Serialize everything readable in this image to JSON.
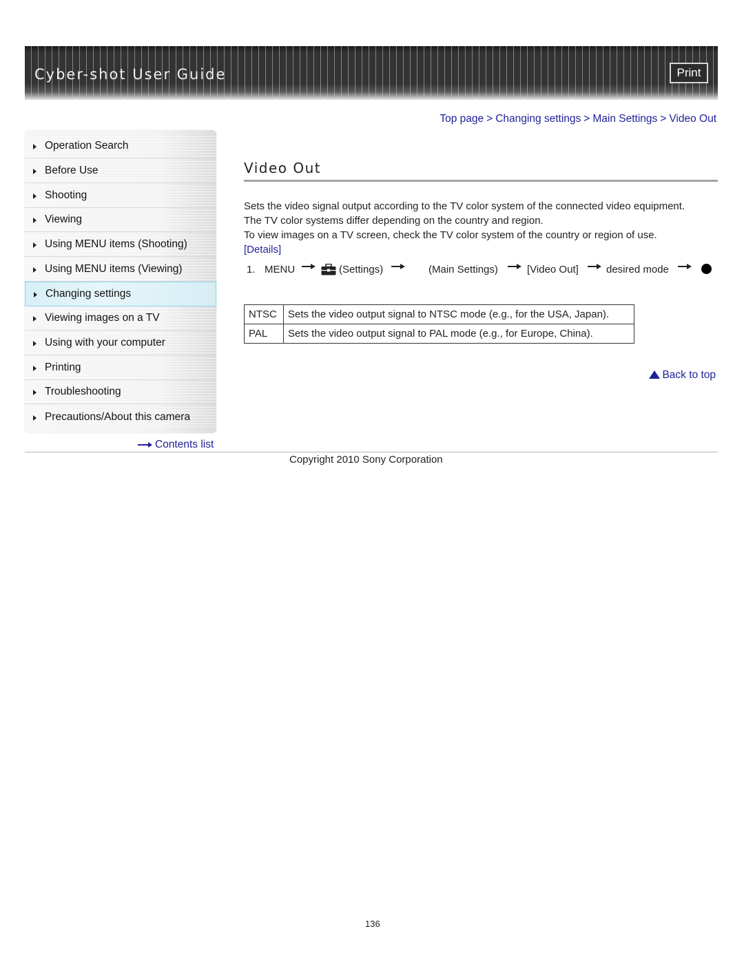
{
  "header": {
    "title": "Cyber-shot User Guide",
    "print_label": "Print"
  },
  "breadcrumb": {
    "items": [
      "Top page",
      "Changing settings",
      "Main Settings",
      "Video Out"
    ],
    "separator": ">"
  },
  "sidebar": {
    "items": [
      {
        "label": "Operation Search",
        "active": false
      },
      {
        "label": "Before Use",
        "active": false
      },
      {
        "label": "Shooting",
        "active": false
      },
      {
        "label": "Viewing",
        "active": false
      },
      {
        "label": "Using MENU items (Shooting)",
        "active": false
      },
      {
        "label": "Using MENU items (Viewing)",
        "active": false
      },
      {
        "label": "Changing settings",
        "active": true
      },
      {
        "label": "Viewing images on a TV",
        "active": false
      },
      {
        "label": "Using with your computer",
        "active": false
      },
      {
        "label": "Printing",
        "active": false
      },
      {
        "label": "Troubleshooting",
        "active": false
      },
      {
        "label": "Precautions/About this camera",
        "active": false
      }
    ],
    "contents_link": "Contents list"
  },
  "main": {
    "title": "Video Out",
    "description": [
      "Sets the video signal output according to the TV color system of the connected video equipment.",
      "The TV color systems differ depending on the country and region.",
      "To view images on a TV screen, check the TV color system of the country or region of use."
    ],
    "details_link": "[Details]",
    "step": {
      "number": "1.",
      "menu": "MENU",
      "settings_icon": "toolbox-icon",
      "settings": "(Settings)",
      "main_settings": "(Main Settings)",
      "video_out": "[Video Out]",
      "desired_mode": "desired mode",
      "confirm_icon": "center-button-dot-icon"
    },
    "modes_table": [
      {
        "mode": "NTSC",
        "description": "Sets the video output signal to NTSC mode (e.g., for the USA, Japan)."
      },
      {
        "mode": "PAL",
        "description": "Sets the video output signal to PAL mode (e.g., for Europe, China)."
      }
    ],
    "back_to_top": "Back to top"
  },
  "footer": {
    "copyright": "Copyright 2010 Sony Corporation",
    "page_number": "136"
  },
  "colors": {
    "link": "#1f1f99",
    "active_nav_bg": "#d6eff5",
    "active_nav_border": "#8fd6ea",
    "banner_dark": "#333333"
  }
}
